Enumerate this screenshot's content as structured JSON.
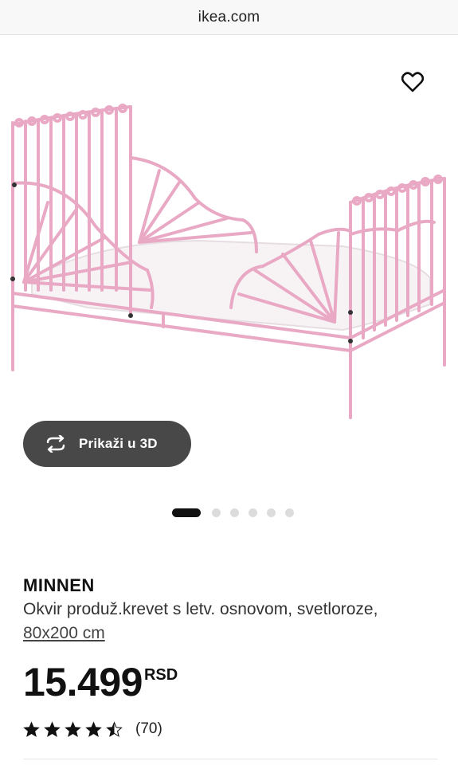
{
  "browser": {
    "url": "ikea.com"
  },
  "gallery": {
    "view_3d_label": "Prikaži u 3D",
    "image_count": 6,
    "active_index": 0,
    "bed_color": "#f0b8cf",
    "favorite_icon": "heart-icon",
    "view_3d_icon": "rotate-icon"
  },
  "product": {
    "name": "MINNEN",
    "description": "Okvir produž.krevet s letv. osnovom, svetloroze,",
    "size_link": "80x200 cm",
    "price": "15.499",
    "currency": "RSD",
    "rating": 4.5,
    "rating_max": 5,
    "review_count": "(70)"
  }
}
